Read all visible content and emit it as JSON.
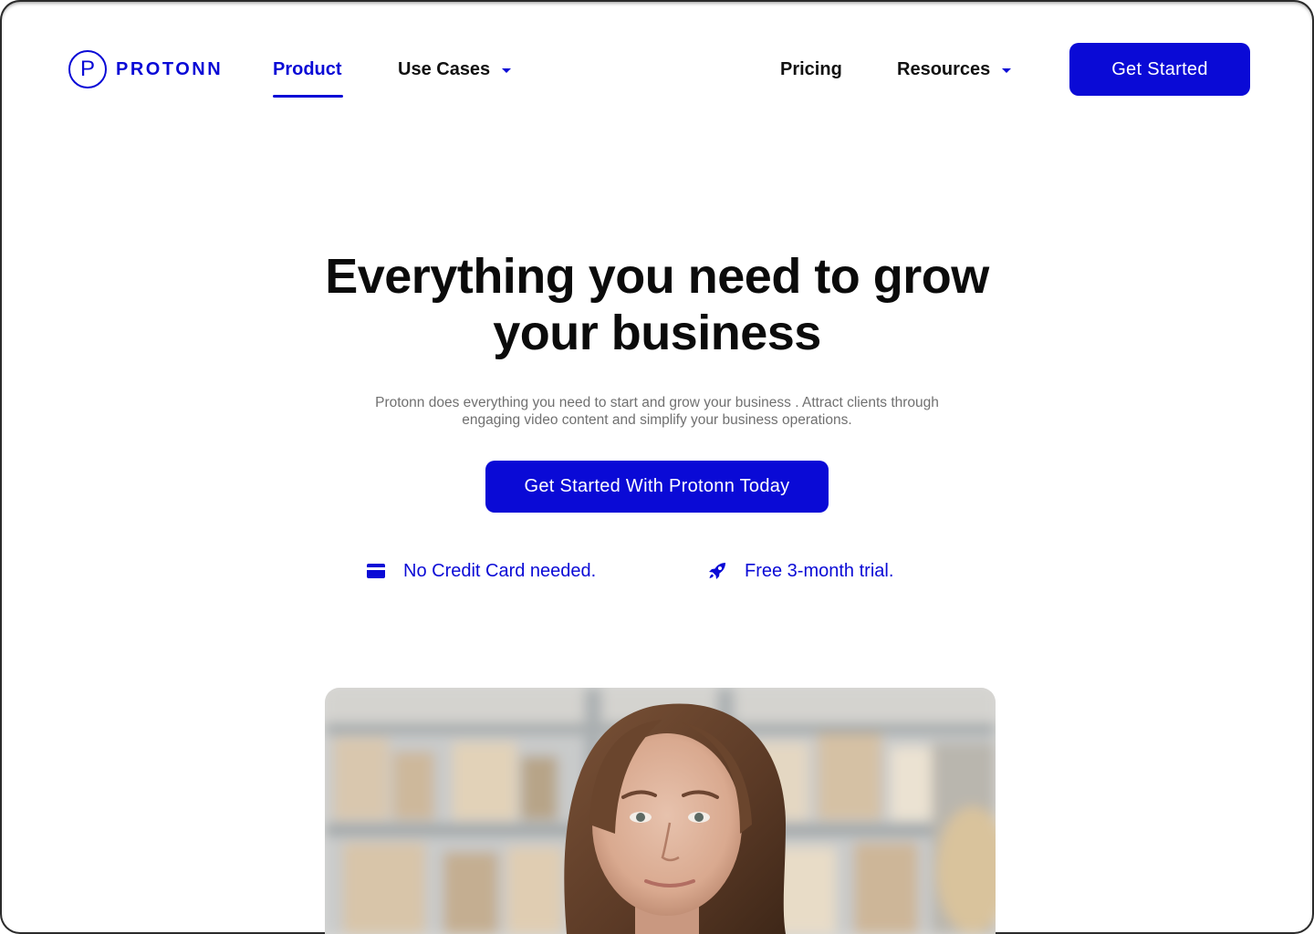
{
  "brand": {
    "logo_letter": "P",
    "name": "PROTONN",
    "accent": "#0a0ad6"
  },
  "nav": {
    "items": [
      {
        "label": "Product",
        "active": true,
        "dropdown": false
      },
      {
        "label": "Use Cases",
        "active": false,
        "dropdown": true
      },
      {
        "label": "Pricing",
        "active": false,
        "dropdown": false
      },
      {
        "label": "Resources",
        "active": false,
        "dropdown": true
      }
    ],
    "cta_label": "Get Started"
  },
  "hero": {
    "title_line1": "Everything you need to grow",
    "title_line2": "your business",
    "subtitle_line1": "Protonn does everything you need to start and grow your business . Attract clients through",
    "subtitle_line2": "engaging video content and simplify your business operations.",
    "cta_label": "Get Started With Protonn Today",
    "features": [
      {
        "icon": "credit-card-icon",
        "text": "No Credit Card needed."
      },
      {
        "icon": "rocket-icon",
        "text": "Free 3-month trial."
      }
    ]
  },
  "media": {
    "image": "portrait-photo"
  }
}
